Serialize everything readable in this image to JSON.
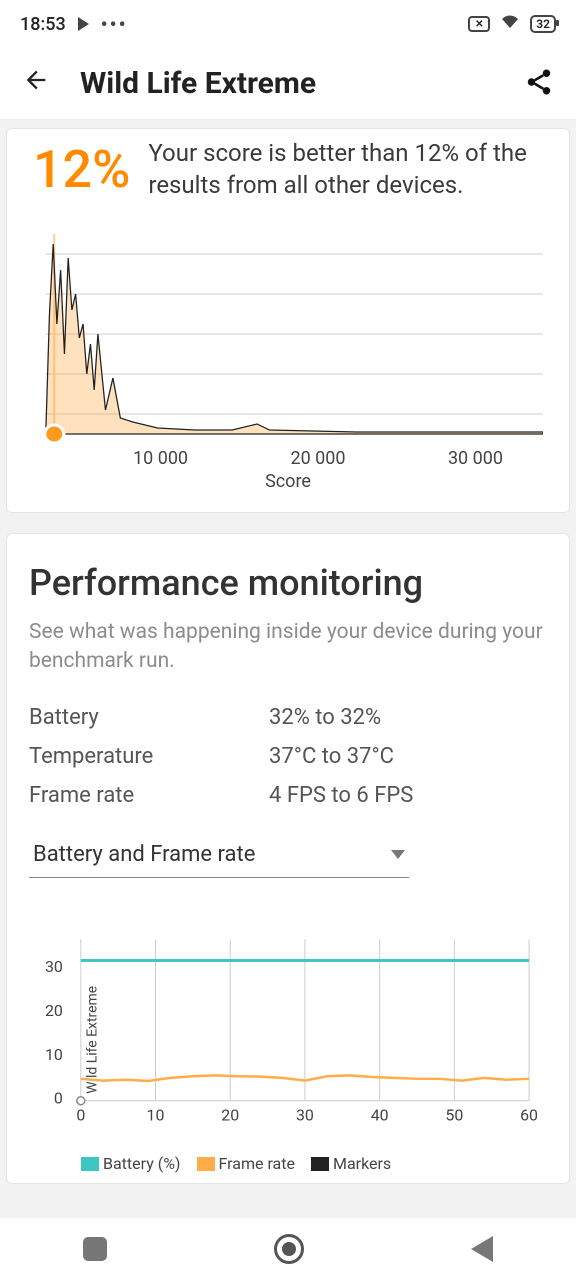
{
  "status": {
    "time": "18:53",
    "battery": "32"
  },
  "header": {
    "title": "Wild Life Extreme"
  },
  "percentile": {
    "value": "12%",
    "text": "Your score is better than 12% of the results from all other devices."
  },
  "chart_data": [
    {
      "type": "area",
      "title": "",
      "xlabel": "Score",
      "ylabel": "",
      "x_ticks": [
        "10 000",
        "20 000",
        "30 000"
      ],
      "marker_x": 800,
      "series": [
        {
          "name": "distribution",
          "x_range": [
            0,
            40000
          ],
          "comment": "Approximate device-score distribution histogram; y in arbitrary density units 0–100",
          "points": [
            [
              0,
              0
            ],
            [
              300,
              60
            ],
            [
              600,
              95
            ],
            [
              900,
              55
            ],
            [
              1200,
              82
            ],
            [
              1500,
              40
            ],
            [
              1800,
              88
            ],
            [
              2100,
              62
            ],
            [
              2400,
              70
            ],
            [
              2700,
              48
            ],
            [
              3000,
              55
            ],
            [
              3300,
              30
            ],
            [
              3600,
              45
            ],
            [
              3900,
              22
            ],
            [
              4200,
              50
            ],
            [
              4800,
              12
            ],
            [
              5400,
              28
            ],
            [
              6000,
              8
            ],
            [
              7000,
              6
            ],
            [
              9000,
              3
            ],
            [
              12000,
              2
            ],
            [
              15000,
              2
            ],
            [
              17000,
              5
            ],
            [
              18000,
              2
            ],
            [
              25000,
              1
            ],
            [
              40000,
              1
            ]
          ]
        }
      ]
    },
    {
      "type": "line",
      "title": "",
      "xlabel": "",
      "ylabel": "",
      "ylim": [
        0,
        35
      ],
      "x_ticks": [
        "0",
        "10",
        "20",
        "30",
        "40",
        "50",
        "60"
      ],
      "y_ticks": [
        "0",
        "10",
        "20",
        "30"
      ],
      "side_label": "Wild Life Extreme",
      "series": [
        {
          "name": "Battery (%)",
          "color": "#3cc7c3",
          "x": [
            0,
            60
          ],
          "y": [
            32,
            32
          ]
        },
        {
          "name": "Frame rate",
          "color": "#ffad4a",
          "x": [
            0,
            3,
            6,
            9,
            12,
            15,
            18,
            21,
            24,
            27,
            30,
            33,
            36,
            39,
            42,
            45,
            48,
            51,
            54,
            57,
            60
          ],
          "y": [
            5.0,
            4.6,
            4.8,
            4.5,
            5.2,
            5.6,
            5.8,
            5.6,
            5.5,
            5.2,
            4.6,
            5.6,
            5.8,
            5.4,
            5.2,
            5.0,
            5.0,
            4.6,
            5.2,
            4.8,
            5.0
          ]
        },
        {
          "name": "Markers",
          "color": "#222",
          "x": [],
          "y": []
        }
      ],
      "legend": [
        "Battery (%)",
        "Frame rate",
        "Markers"
      ]
    }
  ],
  "perf": {
    "title": "Performance monitoring",
    "subtitle": "See what was happening inside your device during your benchmark run.",
    "metrics": [
      {
        "label": "Battery",
        "value": "32% to 32%"
      },
      {
        "label": "Temperature",
        "value": "37°C to 37°C"
      },
      {
        "label": "Frame rate",
        "value": "4 FPS to 6 FPS"
      }
    ],
    "dropdown": "Battery and Frame rate"
  }
}
